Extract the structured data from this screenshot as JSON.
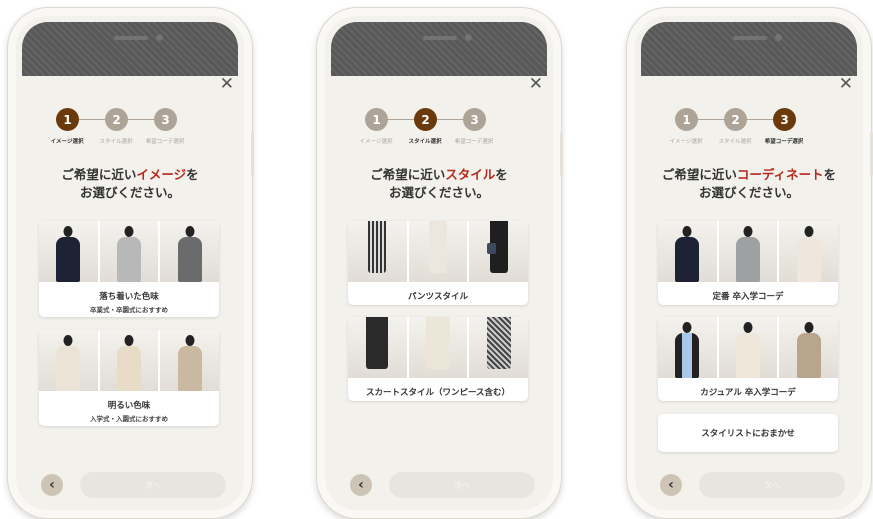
{
  "close_icon": "✕",
  "back_icon": "‹",
  "steps": {
    "numbers": [
      "1",
      "2",
      "3"
    ],
    "labels": [
      "イメージ選択",
      "スタイル選択",
      "希望コーデ選択"
    ]
  },
  "next_label": "次へ",
  "colors": {
    "step_active": "#6b3a0c",
    "step_inactive": "#ada396",
    "highlight": "#b5281d"
  },
  "screens": [
    {
      "active_step": 1,
      "heading": {
        "pre": "ご希望に近い",
        "highlight": "イメージ",
        "post": "を",
        "line2": "お選びください。"
      },
      "options": [
        {
          "label": "落ち着いた色味",
          "sub": "卒業式・卒園式におすすめ"
        },
        {
          "label": "明るい色味",
          "sub": "入学式・入園式におすすめ"
        }
      ]
    },
    {
      "active_step": 2,
      "heading": {
        "pre": "ご希望に近い",
        "highlight": "スタイル",
        "post": "を",
        "line2": "お選びください。"
      },
      "options": [
        {
          "label": "パンツスタイル"
        },
        {
          "label": "スカートスタイル（ワンピース含む）"
        }
      ]
    },
    {
      "active_step": 3,
      "heading": {
        "pre": "ご希望に近い",
        "highlight": "コーディネート",
        "post": "を",
        "line2": "お選びください。"
      },
      "options": [
        {
          "label": "定番 卒入学コーデ"
        },
        {
          "label": "カジュアル 卒入学コーデ"
        }
      ],
      "extra_option": "スタイリストにおまかせ"
    }
  ]
}
